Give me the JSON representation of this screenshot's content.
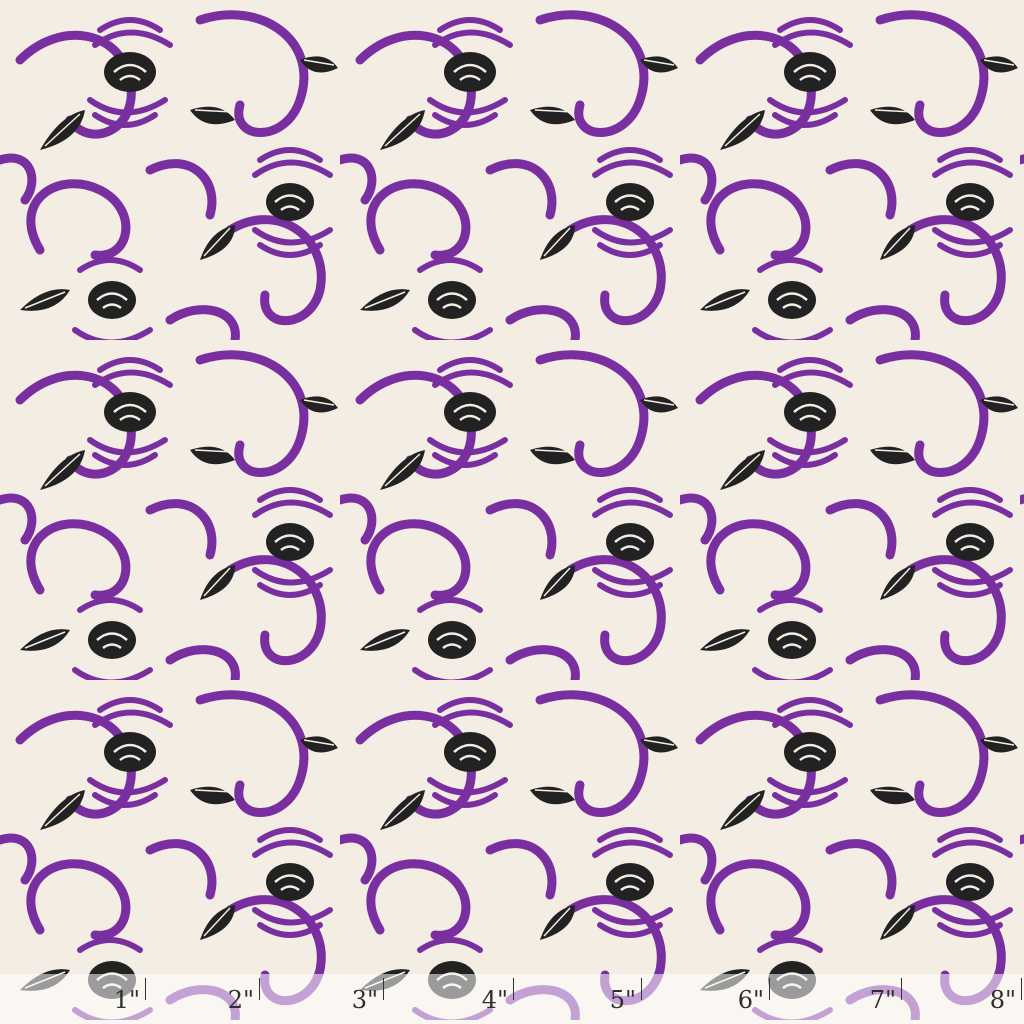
{
  "fabric": {
    "ground_color": "#f3ede3",
    "pattern_color": "#7a2fa0",
    "blossom_color": "#222222",
    "leaf_color": "#222222",
    "motifs": [
      "peony-blossom",
      "leaf",
      "scroll-vine"
    ]
  },
  "ruler": {
    "ticks": [
      "1\"",
      "2\"",
      "3\"",
      "4\"",
      "5\"",
      "6\"",
      "7\"",
      "8\""
    ]
  }
}
